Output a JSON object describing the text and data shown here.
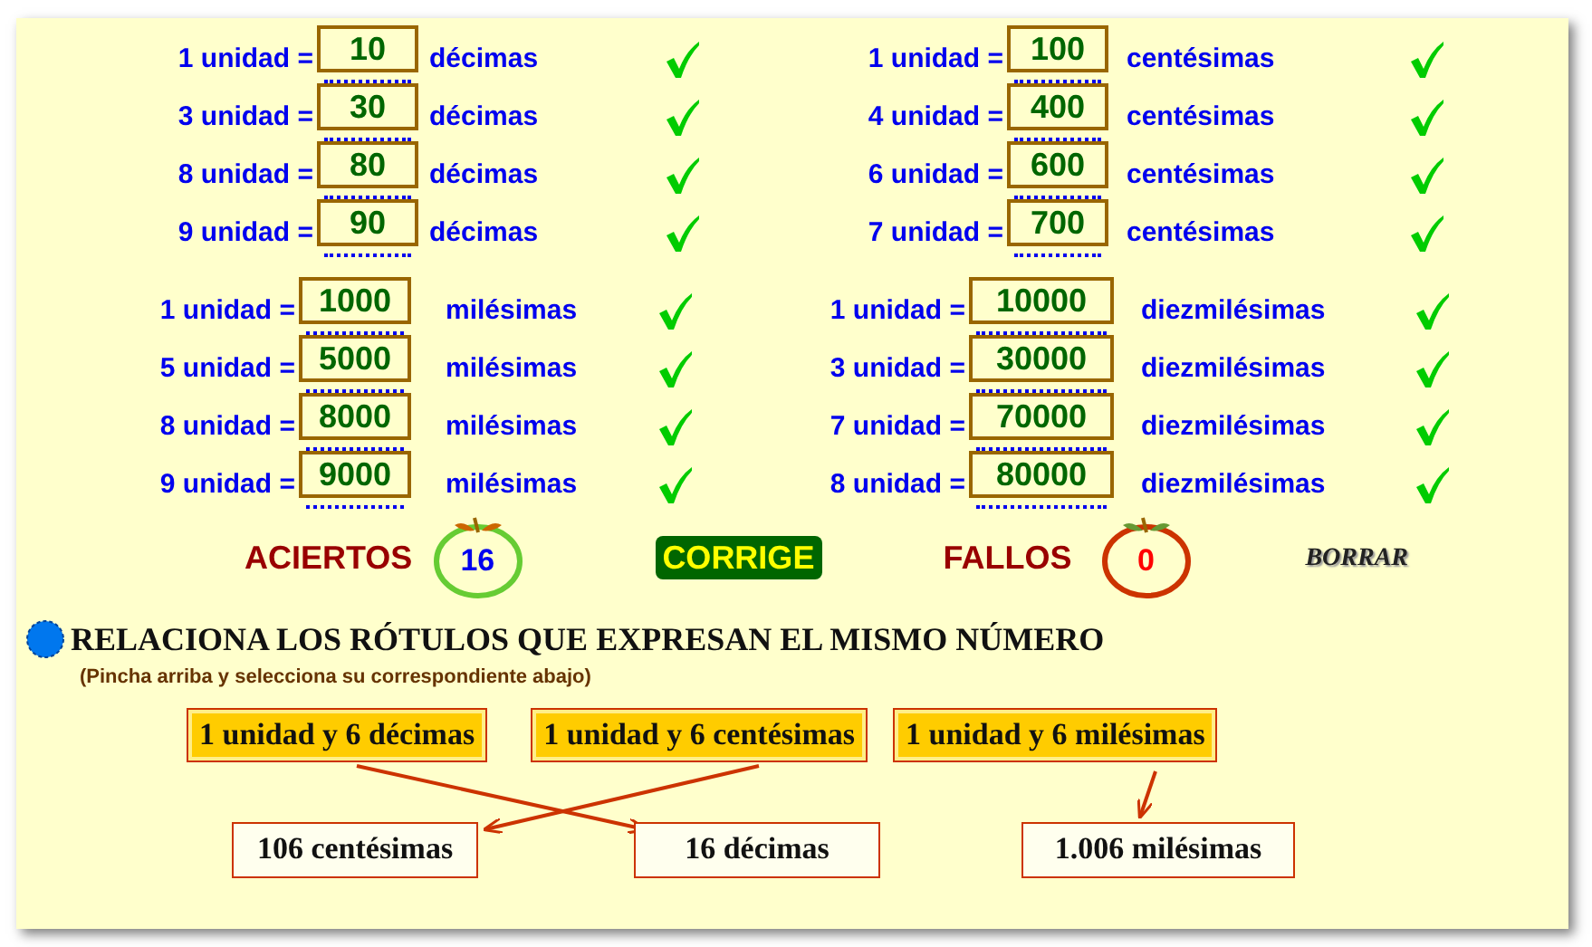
{
  "conversion_sections": [
    {
      "columns": [
        {
          "rows": [
            {
              "label": "1 unidad =",
              "value": "10",
              "unit": "décimas",
              "correct": true
            },
            {
              "label": "3 unidad =",
              "value": "30",
              "unit": "décimas",
              "correct": true
            },
            {
              "label": "8 unidad =",
              "value": "80",
              "unit": "décimas",
              "correct": true
            },
            {
              "label": "9 unidad =",
              "value": "90",
              "unit": "décimas",
              "correct": true
            }
          ]
        },
        {
          "rows": [
            {
              "label": "1 unidad =",
              "value": "100",
              "unit": "centésimas",
              "correct": true
            },
            {
              "label": "4 unidad =",
              "value": "400",
              "unit": "centésimas",
              "correct": true
            },
            {
              "label": "6 unidad =",
              "value": "600",
              "unit": "centésimas",
              "correct": true
            },
            {
              "label": "7 unidad =",
              "value": "700",
              "unit": "centésimas",
              "correct": true
            }
          ]
        }
      ]
    },
    {
      "columns": [
        {
          "rows": [
            {
              "label": "1 unidad =",
              "value": "1000",
              "unit": "milésimas",
              "correct": true
            },
            {
              "label": "5 unidad =",
              "value": "5000",
              "unit": "milésimas",
              "correct": true
            },
            {
              "label": "8 unidad =",
              "value": "8000",
              "unit": "milésimas",
              "correct": true
            },
            {
              "label": "9 unidad =",
              "value": "9000",
              "unit": "milésimas",
              "correct": true
            }
          ]
        },
        {
          "rows": [
            {
              "label": "1 unidad =",
              "value": "10000",
              "unit": "diezmilésimas",
              "correct": true
            },
            {
              "label": "3 unidad =",
              "value": "30000",
              "unit": "diezmilésimas",
              "correct": true
            },
            {
              "label": "7 unidad =",
              "value": "70000",
              "unit": "diezmilésimas",
              "correct": true
            },
            {
              "label": "8 unidad =",
              "value": "80000",
              "unit": "diezmilésimas",
              "correct": true
            }
          ]
        }
      ]
    }
  ],
  "score": {
    "hits_label": "ACIERTOS",
    "hits": "16",
    "check_button": "CORRIGE",
    "misses_label": "FALLOS",
    "misses": "0",
    "clear_button": "BORRAR"
  },
  "matching": {
    "title": "RELACIONA LOS RÓTULOS QUE EXPRESAN EL MISMO NÚMERO",
    "hint": "(Pincha arriba y selecciona su correspondiente abajo)",
    "top": [
      {
        "text": "1 unidad y 6 décimas",
        "kind": "crossright"
      },
      {
        "text": "1 unidad y 6 centésimas",
        "kind": "crossleft"
      },
      {
        "text": "1 unidad y 6 milésimas",
        "kind": "straight"
      }
    ],
    "bottom": [
      "106 centésimas",
      "16 décimas",
      "1.006 milésimas"
    ]
  }
}
